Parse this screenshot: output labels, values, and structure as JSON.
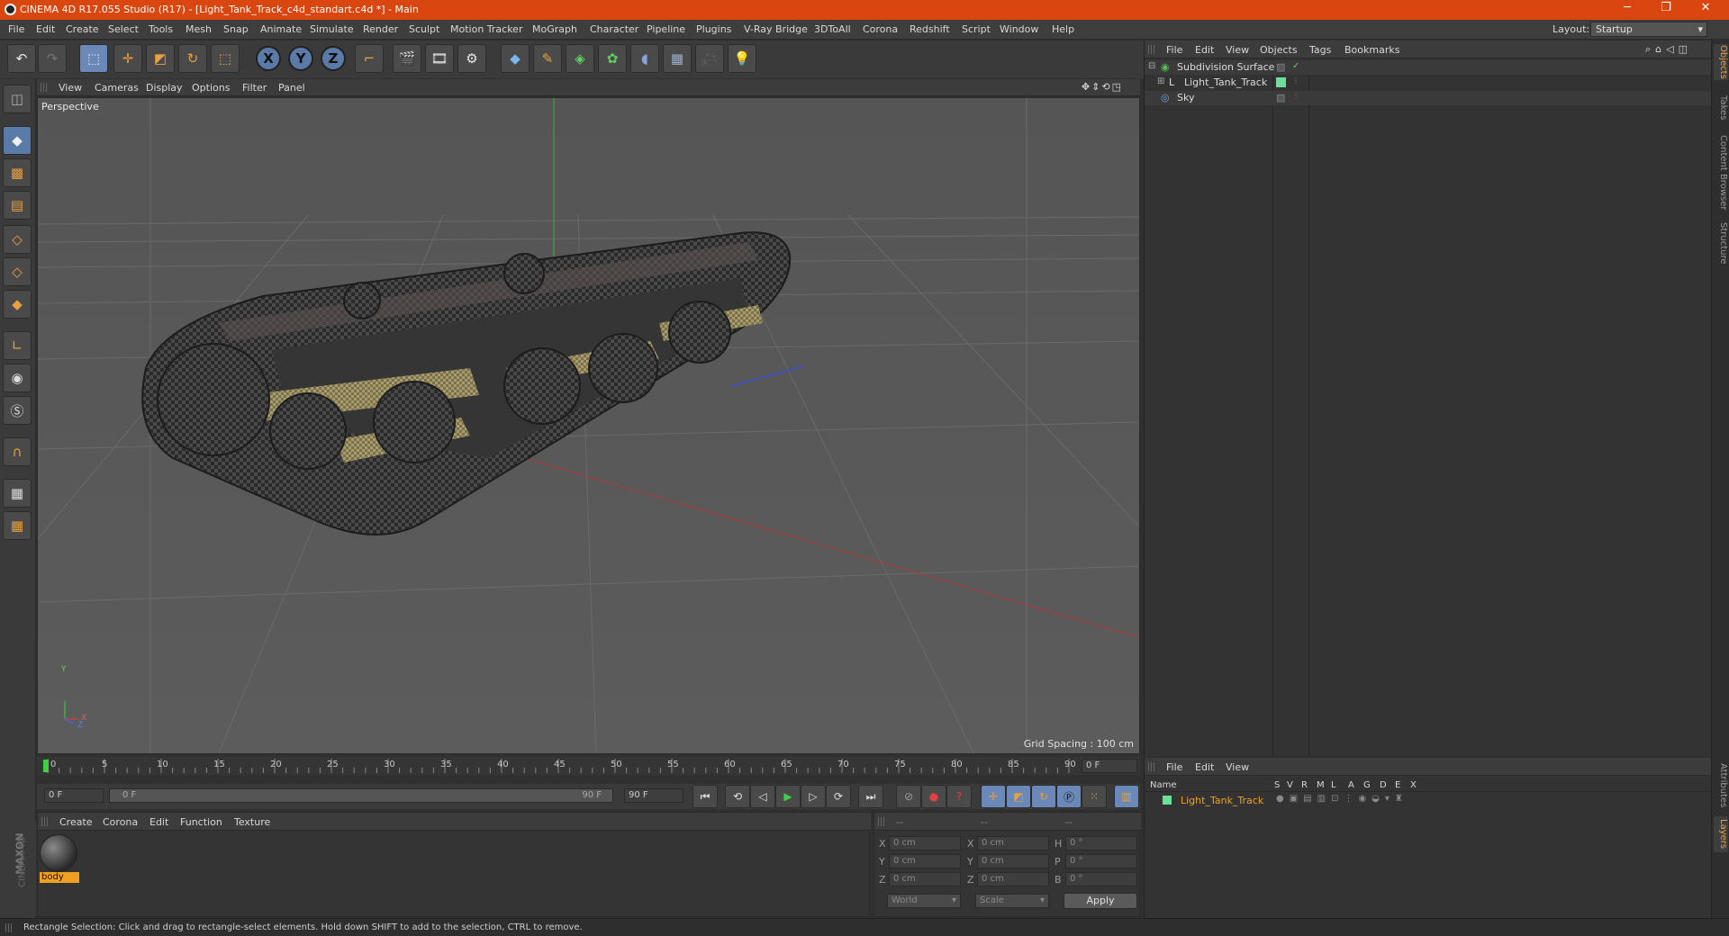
{
  "window": {
    "title": "CINEMA 4D R17.055 Studio (R17) - [Light_Tank_Track_c4d_standart.c4d *] - Main",
    "minimize": "─",
    "restore": "❐",
    "close": "✕"
  },
  "menu": {
    "items": [
      "File",
      "Edit",
      "Create",
      "Select",
      "Tools",
      "Mesh",
      "Snap",
      "Animate",
      "Simulate",
      "Render",
      "Sculpt",
      "Motion Tracker",
      "MoGraph",
      "Character",
      "Pipeline",
      "Plugins",
      "V-Ray Bridge",
      "3DToAll",
      "Corona",
      "Redshift",
      "Script",
      "Window",
      "Help"
    ],
    "layout_label": "Layout:",
    "layout_value": "Startup"
  },
  "toolbar": {
    "axis_x": "X",
    "axis_y": "Y",
    "axis_z": "Z",
    "icons": [
      "undo-icon",
      "redo-icon",
      "select-icon",
      "move-icon",
      "scale-icon",
      "rotate-icon",
      "rect-select-icon",
      "x-axis-icon",
      "y-axis-icon",
      "z-axis-icon",
      "coord-system-icon",
      "render-view-icon",
      "render-picture-viewer-icon",
      "render-settings-icon",
      "cube-icon",
      "pen-icon",
      "subdivide-icon",
      "cloner-icon",
      "deformer-icon",
      "floor-icon",
      "camera-icon",
      "light-icon"
    ]
  },
  "viewport": {
    "menu": [
      "View",
      "Cameras",
      "Display",
      "Options",
      "Filter",
      "Panel"
    ],
    "label": "Perspective",
    "grid_spacing": "Grid Spacing : 100 cm",
    "axis_y": "Y",
    "axis_x": "X",
    "axis_z": "Z"
  },
  "timeline": {
    "ticks": [
      "0",
      "5",
      "10",
      "15",
      "20",
      "25",
      "30",
      "35",
      "40",
      "45",
      "50",
      "55",
      "60",
      "65",
      "70",
      "75",
      "80",
      "85",
      "90"
    ],
    "current_frame": "0 F",
    "start_frame": "0 F",
    "range_start": "0 F",
    "range_end": "90 F",
    "end_frame": "90 F"
  },
  "materials": {
    "menu": [
      "Create",
      "Corona",
      "Edit",
      "Function",
      "Texture"
    ],
    "items": [
      {
        "name": "body"
      }
    ],
    "brand_top": "MAXON",
    "brand_bottom": "CINEMA 4D"
  },
  "coordinates": {
    "header": [
      "--",
      "--",
      "--"
    ],
    "rows": [
      {
        "a": "X",
        "av": "0 cm",
        "b": "X",
        "bv": "0 cm",
        "c": "H",
        "cv": "0 °"
      },
      {
        "a": "Y",
        "av": "0 cm",
        "b": "Y",
        "bv": "0 cm",
        "c": "P",
        "cv": "0 °"
      },
      {
        "a": "Z",
        "av": "0 cm",
        "b": "Z",
        "bv": "0 cm",
        "c": "B",
        "cv": "0 °"
      }
    ],
    "mode1": "World",
    "mode2": "Scale",
    "apply": "Apply"
  },
  "objects_panel": {
    "menu": [
      "File",
      "Edit",
      "View",
      "Objects",
      "Tags",
      "Bookmarks"
    ],
    "items": [
      {
        "name": "Subdivision Surface",
        "color": "#4fbf4f"
      },
      {
        "name": "Light_Tank_Track",
        "color": "#e0e0e0"
      },
      {
        "name": "Sky",
        "color": "#6fa0d8"
      }
    ]
  },
  "layers_panel": {
    "menu": [
      "File",
      "Edit",
      "View"
    ],
    "columns": [
      "Name",
      "S",
      "V",
      "R",
      "M",
      "L",
      "A",
      "G",
      "D",
      "E",
      "X"
    ],
    "rows": [
      {
        "name": "Light_Tank_Track"
      }
    ]
  },
  "side_tabs": [
    "Objects",
    "Takes",
    "Content Browser",
    "Structure",
    "Attributes",
    "Layers"
  ],
  "status": "Rectangle Selection: Click and drag to rectangle-select elements. Hold down SHIFT to add to the selection, CTRL to remove."
}
